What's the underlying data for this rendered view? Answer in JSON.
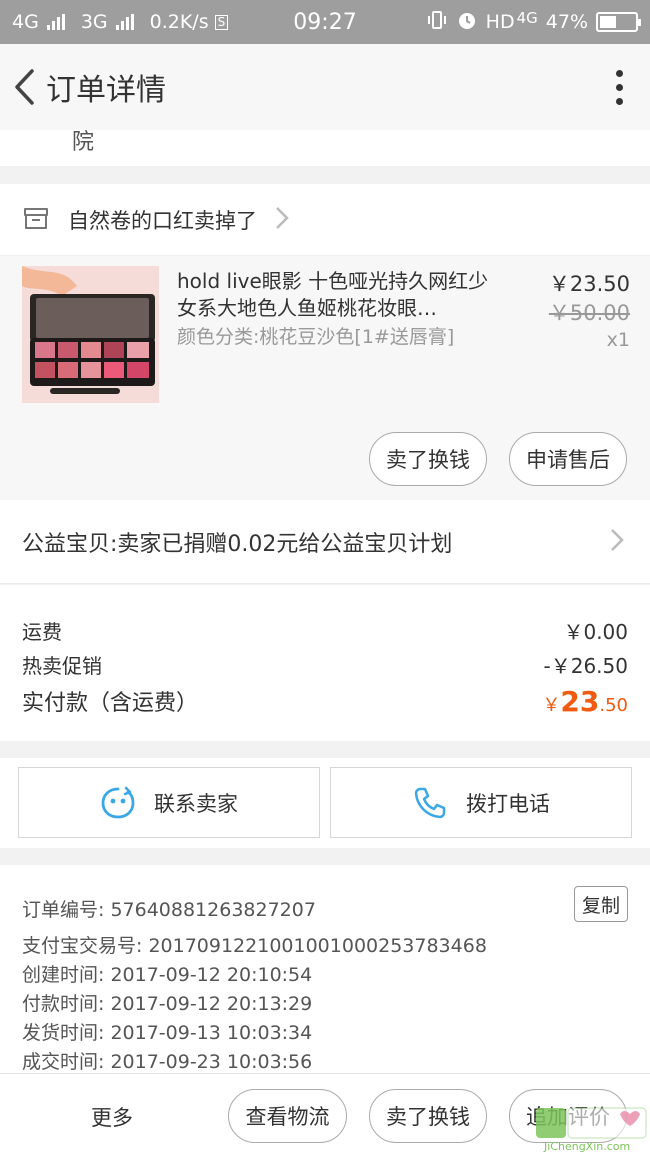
{
  "status_bar": {
    "net1": "4G",
    "net2": "3G",
    "speed": "0.2K/s",
    "sim_badge": "S",
    "time": "09:27",
    "hd": "HD",
    "net3": "4G",
    "battery": "47%",
    "battery_level": 0.47
  },
  "nav": {
    "title": "订单详情"
  },
  "address_fragment": "院",
  "shop": {
    "name": "自然卷的口红卖掉了"
  },
  "product": {
    "title": "hold live眼影 十色哑光持久网红少女系大地色人鱼姬桃花妆眼…",
    "sku": "颜色分类:桃花豆沙色[1#送唇膏]",
    "price": "￥23.50",
    "original_price": "￥50.00",
    "quantity": "x1",
    "btn_sell": "卖了换钱",
    "btn_after_sale": "申请售后"
  },
  "charity": {
    "text": "公益宝贝:卖家已捐赠0.02元给公益宝贝计划"
  },
  "fees": {
    "shipping_label": "运费",
    "shipping_value": "￥0.00",
    "promo_label": "热卖促销",
    "promo_value": "-￥26.50",
    "paid_label": "实付款（含运费）",
    "paid_currency": "￥",
    "paid_int": "23",
    "paid_dec": ".50"
  },
  "contact": {
    "seller": "联系卖家",
    "phone": "拨打电话"
  },
  "order_info": {
    "order_no": "订单编号: 57640881263827207",
    "copy": "复制",
    "alipay_no": "支付宝交易号: 2017091221001001000253783468",
    "created": "创建时间: 2017-09-12 20:10:54",
    "paid": "付款时间: 2017-09-12 20:13:29",
    "shipped": "发货时间: 2017-09-13 10:03:34",
    "completed": "成交时间: 2017-09-23 10:03:56"
  },
  "bottom_bar": {
    "more": "更多",
    "logistics": "查看物流",
    "sell": "卖了换钱",
    "review": "追加评价"
  },
  "watermark": {
    "url": "JiChengXin.com"
  },
  "colors": {
    "accent_orange": "#f25a10",
    "status_bar": "#9e9e9e",
    "icon_blue": "#3aa7e6"
  }
}
